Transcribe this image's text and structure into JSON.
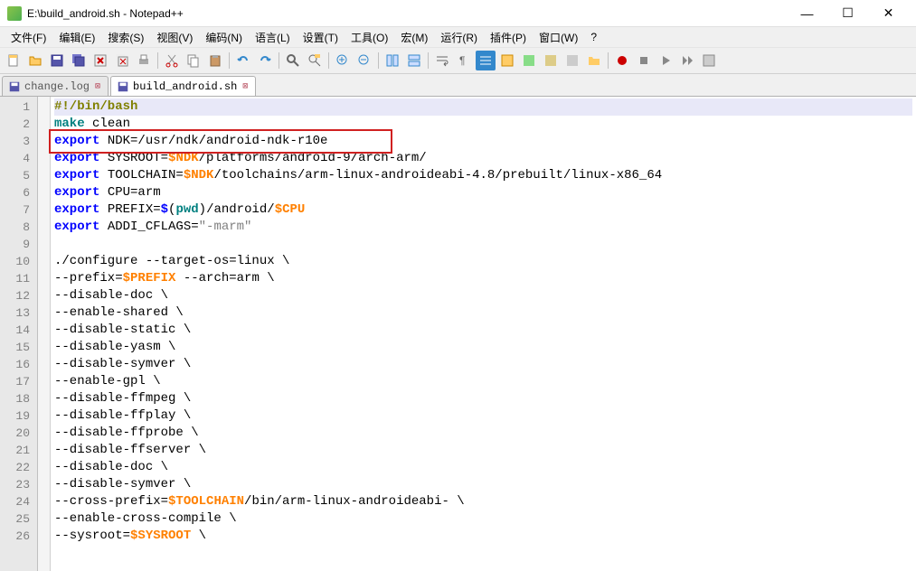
{
  "window": {
    "title": "E:\\build_android.sh - Notepad++",
    "minimize": "—",
    "maximize": "☐",
    "close": "✕"
  },
  "menu": {
    "file": "文件(F)",
    "edit": "编辑(E)",
    "search": "搜索(S)",
    "view": "视图(V)",
    "encoding": "编码(N)",
    "language": "语言(L)",
    "settings": "设置(T)",
    "tools": "工具(O)",
    "macro": "宏(M)",
    "run": "运行(R)",
    "plugins": "插件(P)",
    "window": "窗口(W)",
    "help": "?"
  },
  "tabs": {
    "inactive": {
      "label": "change.log"
    },
    "active": {
      "label": "build_android.sh"
    }
  },
  "code_lines": [
    {
      "n": 1,
      "tokens": [
        [
          "shebang",
          "#!/bin/bash"
        ]
      ]
    },
    {
      "n": 2,
      "tokens": [
        [
          "cmd",
          "make"
        ],
        [
          "plain",
          " clean"
        ]
      ]
    },
    {
      "n": 3,
      "tokens": [
        [
          "kw",
          "export"
        ],
        [
          "plain",
          " NDK=/usr/ndk/android-ndk-r10e"
        ]
      ]
    },
    {
      "n": 4,
      "tokens": [
        [
          "kw",
          "export"
        ],
        [
          "plain",
          " SYSROOT="
        ],
        [
          "var",
          "$NDK"
        ],
        [
          "plain",
          "/platforms/android-9/arch-arm/"
        ]
      ]
    },
    {
      "n": 5,
      "tokens": [
        [
          "kw",
          "export"
        ],
        [
          "plain",
          " TOOLCHAIN="
        ],
        [
          "var",
          "$NDK"
        ],
        [
          "plain",
          "/toolchains/arm-linux-androideabi-4.8/prebuilt/linux-x86_64"
        ]
      ]
    },
    {
      "n": 6,
      "tokens": [
        [
          "kw",
          "export"
        ],
        [
          "plain",
          " CPU=arm"
        ]
      ]
    },
    {
      "n": 7,
      "tokens": [
        [
          "kw",
          "export"
        ],
        [
          "plain",
          " PREFIX="
        ],
        [
          "kw",
          "$"
        ],
        [
          "plain",
          "("
        ],
        [
          "cmd",
          "pwd"
        ],
        [
          "plain",
          ")/android/"
        ],
        [
          "var",
          "$CPU"
        ]
      ]
    },
    {
      "n": 8,
      "tokens": [
        [
          "kw",
          "export"
        ],
        [
          "plain",
          " ADDI_CFLAGS="
        ],
        [
          "str",
          "\"-marm\""
        ]
      ]
    },
    {
      "n": 9,
      "tokens": [
        [
          "plain",
          ""
        ]
      ]
    },
    {
      "n": 10,
      "tokens": [
        [
          "plain",
          "./configure --target-os=linux \\"
        ]
      ]
    },
    {
      "n": 11,
      "tokens": [
        [
          "plain",
          "--prefix="
        ],
        [
          "var",
          "$PREFIX"
        ],
        [
          "plain",
          " --arch=arm \\"
        ]
      ]
    },
    {
      "n": 12,
      "tokens": [
        [
          "plain",
          "--disable-doc \\"
        ]
      ]
    },
    {
      "n": 13,
      "tokens": [
        [
          "plain",
          "--enable-shared \\"
        ]
      ]
    },
    {
      "n": 14,
      "tokens": [
        [
          "plain",
          "--disable-static \\"
        ]
      ]
    },
    {
      "n": 15,
      "tokens": [
        [
          "plain",
          "--disable-yasm \\"
        ]
      ]
    },
    {
      "n": 16,
      "tokens": [
        [
          "plain",
          "--disable-symver \\"
        ]
      ]
    },
    {
      "n": 17,
      "tokens": [
        [
          "plain",
          "--enable-gpl \\"
        ]
      ]
    },
    {
      "n": 18,
      "tokens": [
        [
          "plain",
          "--disable-ffmpeg \\"
        ]
      ]
    },
    {
      "n": 19,
      "tokens": [
        [
          "plain",
          "--disable-ffplay \\"
        ]
      ]
    },
    {
      "n": 20,
      "tokens": [
        [
          "plain",
          "--disable-ffprobe \\"
        ]
      ]
    },
    {
      "n": 21,
      "tokens": [
        [
          "plain",
          "--disable-ffserver \\"
        ]
      ]
    },
    {
      "n": 22,
      "tokens": [
        [
          "plain",
          "--disable-doc \\"
        ]
      ]
    },
    {
      "n": 23,
      "tokens": [
        [
          "plain",
          "--disable-symver \\"
        ]
      ]
    },
    {
      "n": 24,
      "tokens": [
        [
          "plain",
          "--cross-prefix="
        ],
        [
          "var",
          "$TOOLCHAIN"
        ],
        [
          "plain",
          "/bin/arm-linux-androideabi- \\"
        ]
      ]
    },
    {
      "n": 25,
      "tokens": [
        [
          "plain",
          "--enable-cross-compile \\"
        ]
      ]
    },
    {
      "n": 26,
      "tokens": [
        [
          "plain",
          "--sysroot="
        ],
        [
          "var",
          "$SYSROOT"
        ],
        [
          "plain",
          " \\"
        ]
      ]
    }
  ],
  "highlight": {
    "line": 3
  },
  "cursor_line": 1
}
